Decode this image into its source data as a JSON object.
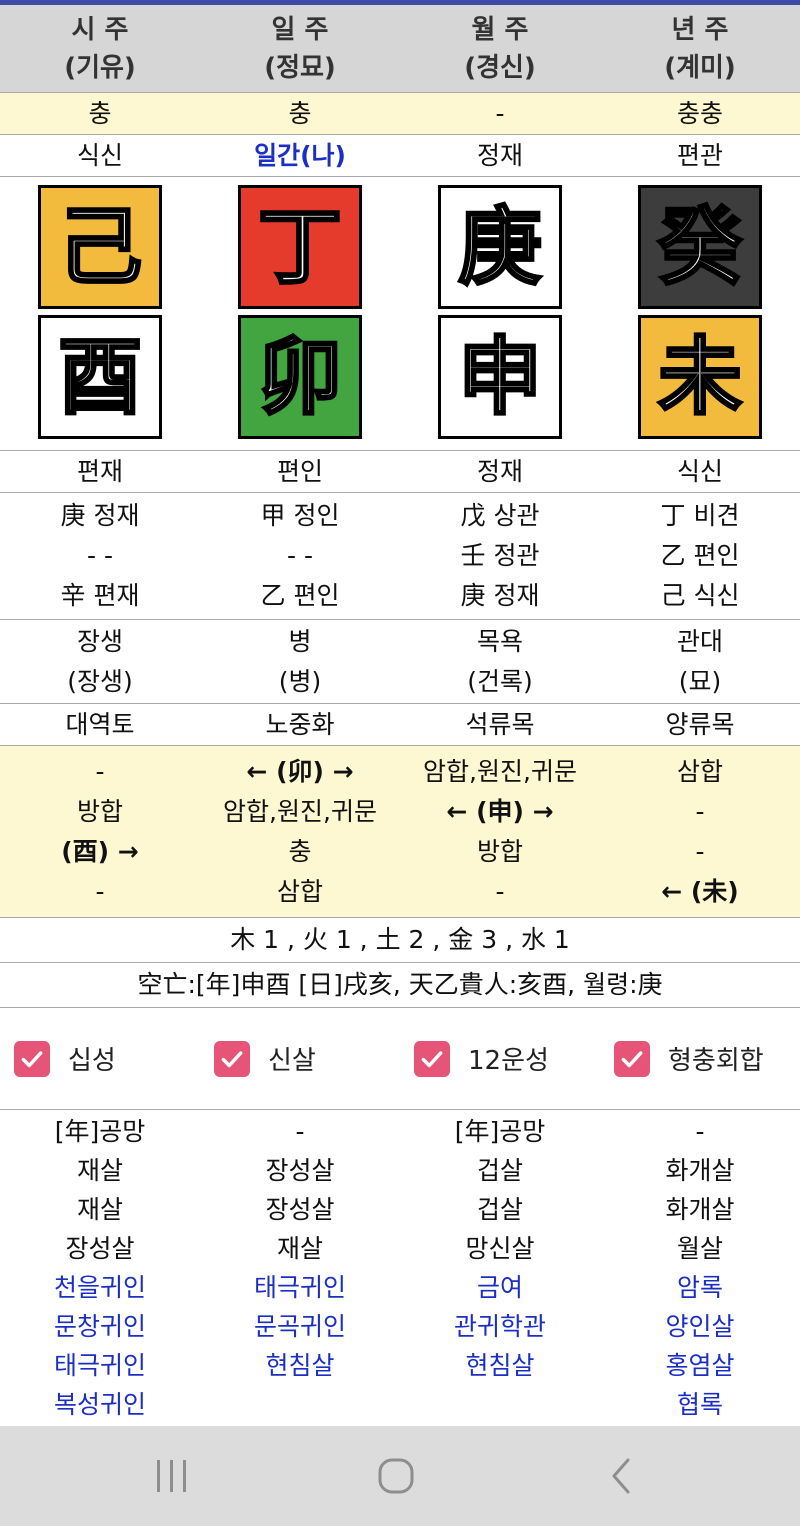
{
  "columns": [
    {
      "title": "시 주",
      "sub": "(기유)",
      "clash": "충",
      "top_god": "식신",
      "stem": {
        "char": "己",
        "color": "#f2bb3d"
      },
      "branch": {
        "char": "酉",
        "color": "#ffffff"
      },
      "bottom_god": "편재",
      "hidden": [
        "庚 정재",
        "- -",
        "辛 편재"
      ],
      "stage": "장생",
      "stage2": "(장생)",
      "napeum": "대역토",
      "relations": [
        "-",
        "방합",
        "(酉) →",
        "-"
      ],
      "shinsal": [
        "[年]공망",
        "재살",
        "재살",
        "장성살"
      ],
      "gwiin": [
        "천을귀인",
        "문창귀인",
        "태극귀인",
        "복성귀인"
      ]
    },
    {
      "title": "일 주",
      "sub": "(정묘)",
      "clash": "충",
      "top_god": "일간(나)",
      "stem": {
        "char": "丁",
        "color": "#e43b2c"
      },
      "branch": {
        "char": "卯",
        "color": "#43a53f"
      },
      "bottom_god": "편인",
      "hidden": [
        "甲 정인",
        "- -",
        "乙 편인"
      ],
      "stage": "병",
      "stage2": "(병)",
      "napeum": "노중화",
      "relations": [
        "← (卯) →",
        "암합,원진,귀문",
        "충",
        "삼합"
      ],
      "shinsal": [
        "-",
        "장성살",
        "장성살",
        "재살"
      ],
      "gwiin": [
        "태극귀인",
        "문곡귀인",
        "현침살"
      ]
    },
    {
      "title": "월 주",
      "sub": "(경신)",
      "clash": "-",
      "top_god": "정재",
      "stem": {
        "char": "庚",
        "color": "#ffffff"
      },
      "branch": {
        "char": "申",
        "color": "#ffffff"
      },
      "bottom_god": "정재",
      "hidden": [
        "戊 상관",
        "壬 정관",
        "庚 정재"
      ],
      "stage": "목욕",
      "stage2": "(건록)",
      "napeum": "석류목",
      "relations": [
        "암합,원진,귀문",
        "← (申) →",
        "방합",
        "-"
      ],
      "shinsal": [
        "[年]공망",
        "겁살",
        "겁살",
        "망신살"
      ],
      "gwiin": [
        "금여",
        "관귀학관",
        "현침살"
      ]
    },
    {
      "title": "년 주",
      "sub": "(계미)",
      "clash": "충충",
      "top_god": "편관",
      "stem": {
        "char": "癸",
        "color": "#3d3d3d"
      },
      "branch": {
        "char": "未",
        "color": "#f2bb3d"
      },
      "bottom_god": "식신",
      "hidden": [
        "丁 비견",
        "乙 편인",
        "己 식신"
      ],
      "stage": "관대",
      "stage2": "(묘)",
      "napeum": "양류목",
      "relations": [
        "삼합",
        "-",
        "-",
        "← (未)"
      ],
      "shinsal": [
        "-",
        "화개살",
        "화개살",
        "월살"
      ],
      "gwiin": [
        "암록",
        "양인살",
        "홍염살",
        "협록"
      ]
    }
  ],
  "elements": "木 1 , 火 1 , 土 2 , 金 3 , 水 1",
  "gongmang": "空亡:[年]申酉 [日]戌亥, 天乙貴人:亥酉, 월령:庚",
  "checkboxes": [
    {
      "label": "십성",
      "checked": true
    },
    {
      "label": "신살",
      "checked": true
    },
    {
      "label": "12운성",
      "checked": true
    },
    {
      "label": "형충회합",
      "checked": true
    }
  ],
  "colors": {
    "accent_bar": "#3f4aa8",
    "checkbox": "#e65577",
    "highlight_bg": "#fdf8d2",
    "self_blue": "#1c2fc4"
  }
}
